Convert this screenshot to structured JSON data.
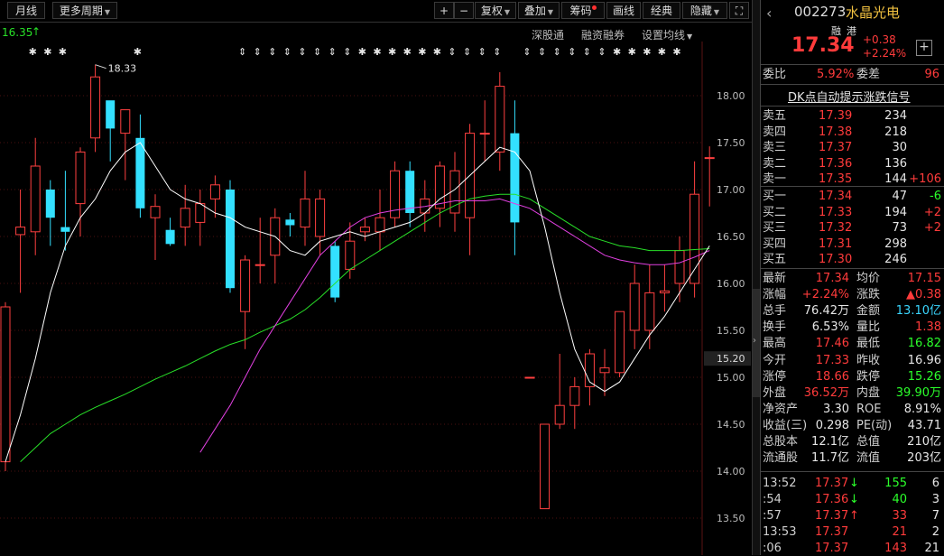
{
  "toolbar": {
    "left_buttons": [
      {
        "label": "月线",
        "has_caret": false
      },
      {
        "label": "更多周期",
        "has_caret": true
      }
    ],
    "right_buttons": [
      {
        "label": "+",
        "has_caret": false
      },
      {
        "label": "−",
        "has_caret": false
      },
      {
        "label": "复权",
        "has_caret": true
      },
      {
        "label": "叠加",
        "has_caret": true
      },
      {
        "label": "筹码",
        "has_caret": false,
        "dot": true
      },
      {
        "label": "画线",
        "has_caret": false
      },
      {
        "label": "经典",
        "has_caret": false
      },
      {
        "label": "隐藏",
        "has_caret": true
      },
      {
        "label": "⛶",
        "has_caret": false
      }
    ]
  },
  "subbar": {
    "indicator_value": "16.35",
    "indicator_arrow": "↑",
    "links": [
      "深股通",
      "融资融券",
      "设置均线"
    ]
  },
  "chart_data": {
    "type": "candlestick",
    "ylim": [
      13.35,
      18.35
    ],
    "y_ticks": [
      13.5,
      14.0,
      14.5,
      15.0,
      15.5,
      16.0,
      16.5,
      17.0,
      17.5,
      18.0
    ],
    "current_price_label": "15.20",
    "high_annotation": "18.33",
    "colors": {
      "up": "#ff4040",
      "down": "#33e0ff",
      "ma5": "#ffffff",
      "ma10": "#e040e0",
      "ma20": "#28e028",
      "grid": "#4a1010"
    },
    "candles": [
      {
        "o": 14.1,
        "h": 15.8,
        "l": 14.0,
        "c": 15.75
      },
      {
        "o": 16.52,
        "h": 17.0,
        "l": 15.9,
        "c": 16.6
      },
      {
        "o": 16.55,
        "h": 17.55,
        "l": 16.3,
        "c": 17.25
      },
      {
        "o": 17.0,
        "h": 17.1,
        "l": 16.4,
        "c": 16.7
      },
      {
        "o": 16.6,
        "h": 17.2,
        "l": 16.35,
        "c": 16.55
      },
      {
        "o": 16.85,
        "h": 17.45,
        "l": 16.5,
        "c": 17.4
      },
      {
        "o": 17.55,
        "h": 18.33,
        "l": 17.4,
        "c": 18.2
      },
      {
        "o": 17.95,
        "h": 17.9,
        "l": 17.3,
        "c": 17.65
      },
      {
        "o": 17.6,
        "h": 17.85,
        "l": 17.1,
        "c": 17.85
      },
      {
        "o": 17.55,
        "h": 17.8,
        "l": 16.7,
        "c": 16.8
      },
      {
        "o": 16.7,
        "h": 16.95,
        "l": 16.25,
        "c": 16.82
      },
      {
        "o": 16.57,
        "h": 16.7,
        "l": 16.4,
        "c": 16.42
      },
      {
        "o": 16.6,
        "h": 17.05,
        "l": 16.4,
        "c": 16.8
      },
      {
        "o": 16.65,
        "h": 17.0,
        "l": 16.4,
        "c": 16.85
      },
      {
        "o": 16.9,
        "h": 17.15,
        "l": 16.7,
        "c": 17.05
      },
      {
        "o": 17.0,
        "h": 17.1,
        "l": 15.9,
        "c": 15.95
      },
      {
        "o": 15.7,
        "h": 16.3,
        "l": 15.3,
        "c": 16.25
      },
      {
        "o": 16.2,
        "h": 16.7,
        "l": 16.0,
        "c": 16.2
      },
      {
        "o": 16.3,
        "h": 16.8,
        "l": 16.0,
        "c": 16.7
      },
      {
        "o": 16.68,
        "h": 16.75,
        "l": 16.5,
        "c": 16.62
      },
      {
        "o": 16.6,
        "h": 17.2,
        "l": 16.4,
        "c": 16.9
      },
      {
        "o": 16.5,
        "h": 17.0,
        "l": 16.3,
        "c": 16.9
      },
      {
        "o": 16.4,
        "h": 16.45,
        "l": 15.8,
        "c": 15.85
      },
      {
        "o": 16.15,
        "h": 16.65,
        "l": 16.05,
        "c": 16.45
      },
      {
        "o": 16.55,
        "h": 16.7,
        "l": 16.45,
        "c": 16.6
      },
      {
        "o": 16.55,
        "h": 17.0,
        "l": 16.35,
        "c": 16.7
      },
      {
        "o": 16.7,
        "h": 17.3,
        "l": 16.6,
        "c": 17.2
      },
      {
        "o": 17.2,
        "h": 17.3,
        "l": 16.6,
        "c": 16.75
      },
      {
        "o": 16.75,
        "h": 17.1,
        "l": 16.55,
        "c": 16.9
      },
      {
        "o": 16.8,
        "h": 17.3,
        "l": 16.6,
        "c": 17.25
      },
      {
        "o": 16.75,
        "h": 17.4,
        "l": 16.55,
        "c": 17.2
      },
      {
        "o": 16.7,
        "h": 17.7,
        "l": 16.3,
        "c": 17.6
      },
      {
        "o": 17.6,
        "h": 17.95,
        "l": 17.3,
        "c": 17.6
      },
      {
        "o": 17.4,
        "h": 18.25,
        "l": 17.2,
        "c": 18.1
      },
      {
        "o": 17.6,
        "h": 17.95,
        "l": 16.3,
        "c": 16.65
      },
      {
        "o": 15.0,
        "h": 15.0,
        "l": 15.0,
        "c": 15.0
      },
      {
        "o": 13.6,
        "h": 14.5,
        "l": 13.6,
        "c": 14.5
      },
      {
        "o": 14.5,
        "h": 15.25,
        "l": 14.45,
        "c": 14.7
      },
      {
        "o": 14.7,
        "h": 15.0,
        "l": 14.45,
        "c": 14.9
      },
      {
        "o": 14.9,
        "h": 15.3,
        "l": 14.7,
        "c": 15.25
      },
      {
        "o": 15.05,
        "h": 15.3,
        "l": 14.8,
        "c": 15.1
      },
      {
        "o": 15.05,
        "h": 15.7,
        "l": 15.0,
        "c": 15.7
      },
      {
        "o": 15.5,
        "h": 16.2,
        "l": 15.3,
        "c": 16.0
      },
      {
        "o": 15.5,
        "h": 16.2,
        "l": 15.3,
        "c": 15.9
      },
      {
        "o": 15.9,
        "h": 16.2,
        "l": 15.7,
        "c": 15.92
      },
      {
        "o": 16.0,
        "h": 16.5,
        "l": 15.8,
        "c": 16.35
      },
      {
        "o": 16.0,
        "h": 17.3,
        "l": 15.85,
        "c": 16.95
      },
      {
        "o": 17.34,
        "h": 17.46,
        "l": 16.82,
        "c": 17.34
      }
    ],
    "ma5": [
      14.1,
      14.6,
      15.2,
      15.9,
      16.4,
      16.7,
      16.9,
      17.2,
      17.4,
      17.5,
      17.25,
      17.0,
      16.9,
      16.85,
      16.75,
      16.7,
      16.6,
      16.55,
      16.5,
      16.35,
      16.3,
      16.45,
      16.5,
      16.55,
      16.5,
      16.55,
      16.6,
      16.65,
      16.75,
      16.9,
      17.0,
      17.15,
      17.3,
      17.45,
      17.4,
      17.2,
      16.6,
      15.9,
      15.3,
      14.95,
      14.85,
      14.95,
      15.2,
      15.45,
      15.65,
      15.9,
      16.15,
      16.4
    ],
    "ma10": [
      null,
      null,
      null,
      null,
      null,
      null,
      null,
      null,
      null,
      null,
      null,
      null,
      null,
      14.2,
      14.45,
      14.7,
      15.0,
      15.3,
      15.55,
      15.8,
      16.05,
      16.3,
      16.45,
      16.6,
      16.7,
      16.75,
      16.78,
      16.8,
      16.82,
      16.85,
      16.88,
      16.88,
      16.88,
      16.9,
      16.85,
      16.8,
      16.7,
      16.6,
      16.5,
      16.4,
      16.3,
      16.25,
      16.22,
      16.2,
      16.2,
      16.22,
      16.28,
      16.35
    ],
    "ma20": [
      null,
      14.1,
      14.25,
      14.4,
      14.5,
      14.6,
      14.68,
      14.75,
      14.82,
      14.9,
      14.98,
      15.05,
      15.12,
      15.2,
      15.28,
      15.35,
      15.4,
      15.48,
      15.55,
      15.62,
      15.72,
      15.85,
      16.0,
      16.15,
      16.25,
      16.35,
      16.45,
      16.55,
      16.65,
      16.75,
      16.83,
      16.9,
      16.93,
      16.95,
      16.95,
      16.9,
      16.8,
      16.7,
      16.6,
      16.5,
      16.45,
      16.4,
      16.38,
      16.35,
      16.35,
      16.35,
      16.36,
      16.37
    ],
    "top_markers": [
      {
        "idx": 2,
        "sym": "✱"
      },
      {
        "idx": 3,
        "sym": "✱"
      },
      {
        "idx": 4,
        "sym": "✱"
      },
      {
        "idx": 9,
        "sym": "✱"
      },
      {
        "idx": 16,
        "sym": "⇕"
      },
      {
        "idx": 17,
        "sym": "⇕"
      },
      {
        "idx": 18,
        "sym": "⇕"
      },
      {
        "idx": 19,
        "sym": "⇕"
      },
      {
        "idx": 20,
        "sym": "⇕"
      },
      {
        "idx": 21,
        "sym": "⇕"
      },
      {
        "idx": 22,
        "sym": "⇕"
      },
      {
        "idx": 23,
        "sym": "⇕"
      },
      {
        "idx": 24,
        "sym": "✱"
      },
      {
        "idx": 25,
        "sym": "✱"
      },
      {
        "idx": 26,
        "sym": "✱"
      },
      {
        "idx": 27,
        "sym": "✱"
      },
      {
        "idx": 28,
        "sym": "✱"
      },
      {
        "idx": 29,
        "sym": "✱"
      },
      {
        "idx": 30,
        "sym": "⇕"
      },
      {
        "idx": 31,
        "sym": "⇕"
      },
      {
        "idx": 32,
        "sym": "⇕"
      },
      {
        "idx": 33,
        "sym": "⇕"
      },
      {
        "idx": 35,
        "sym": "⇕"
      },
      {
        "idx": 36,
        "sym": "⇕"
      },
      {
        "idx": 37,
        "sym": "⇕"
      },
      {
        "idx": 38,
        "sym": "⇕"
      },
      {
        "idx": 39,
        "sym": "⇕"
      },
      {
        "idx": 40,
        "sym": "⇕"
      },
      {
        "idx": 41,
        "sym": "✱"
      },
      {
        "idx": 42,
        "sym": "✱"
      },
      {
        "idx": 43,
        "sym": "✱"
      },
      {
        "idx": 44,
        "sym": "✱"
      },
      {
        "idx": 45,
        "sym": "✱"
      }
    ]
  },
  "quote": {
    "code": "002273",
    "name": "水晶光电",
    "badges": [
      "融",
      "港"
    ],
    "price": "17.34",
    "change": "+0.38",
    "change_pct": "+2.24%",
    "weibi_label": "委比",
    "weibi": "5.92%",
    "weicha_label": "委差",
    "weicha": "96",
    "dk_text": "DK点自动提示涨跌信号",
    "asks": [
      {
        "label": "卖五",
        "price": "17.39",
        "vol": "234",
        "delta": ""
      },
      {
        "label": "卖四",
        "price": "17.38",
        "vol": "218",
        "delta": ""
      },
      {
        "label": "卖三",
        "price": "17.37",
        "vol": "30",
        "delta": ""
      },
      {
        "label": "卖二",
        "price": "17.36",
        "vol": "136",
        "delta": ""
      },
      {
        "label": "卖一",
        "price": "17.35",
        "vol": "144",
        "delta": "+106"
      }
    ],
    "bids": [
      {
        "label": "买一",
        "price": "17.34",
        "vol": "47",
        "delta": "-6"
      },
      {
        "label": "买二",
        "price": "17.33",
        "vol": "194",
        "delta": "+2"
      },
      {
        "label": "买三",
        "price": "17.32",
        "vol": "73",
        "delta": "+2"
      },
      {
        "label": "买四",
        "price": "17.31",
        "vol": "298",
        "delta": ""
      },
      {
        "label": "买五",
        "price": "17.30",
        "vol": "246",
        "delta": ""
      }
    ],
    "stats": [
      {
        "l1": "最新",
        "v1": "17.34",
        "c1": "red",
        "l2": "均价",
        "v2": "17.15",
        "c2": "red"
      },
      {
        "l1": "涨幅",
        "v1": "+2.24%",
        "c1": "red",
        "l2": "涨跌",
        "v2": "▲0.38",
        "c2": "red"
      },
      {
        "l1": "总手",
        "v1": "76.42万",
        "c1": "white",
        "l2": "金额",
        "v2": "13.10亿",
        "c2": "cyan"
      },
      {
        "l1": "换手",
        "v1": "6.53%",
        "c1": "white",
        "l2": "量比",
        "v2": "1.38",
        "c2": "red"
      },
      {
        "l1": "最高",
        "v1": "17.46",
        "c1": "red",
        "l2": "最低",
        "v2": "16.82",
        "c2": "green"
      },
      {
        "l1": "今开",
        "v1": "17.33",
        "c1": "red",
        "l2": "昨收",
        "v2": "16.96",
        "c2": "white"
      },
      {
        "l1": "涨停",
        "v1": "18.66",
        "c1": "red",
        "l2": "跌停",
        "v2": "15.26",
        "c2": "green"
      },
      {
        "l1": "外盘",
        "v1": "36.52万",
        "c1": "red",
        "l2": "内盘",
        "v2": "39.90万",
        "c2": "green"
      },
      {
        "l1": "净资产",
        "v1": "3.30",
        "c1": "white",
        "l2": "ROE",
        "v2": "8.91%",
        "c2": "white"
      },
      {
        "l1": "收益(三)",
        "v1": "0.298",
        "c1": "white",
        "l2": "PE(动)",
        "v2": "43.71",
        "c2": "white"
      },
      {
        "l1": "总股本",
        "v1": "12.1亿",
        "c1": "white",
        "l2": "总值",
        "v2": "210亿",
        "c2": "white"
      },
      {
        "l1": "流通股",
        "v1": "11.7亿",
        "c1": "white",
        "l2": "流值",
        "v2": "203亿",
        "c2": "white"
      }
    ],
    "ticks": [
      {
        "time": "13:52",
        "price": "17.37",
        "arrow": "↓",
        "arrow_color": "green",
        "vol": "155",
        "vol_color": "green",
        "n": "6"
      },
      {
        "time": ":54",
        "price": "17.36",
        "arrow": "↓",
        "arrow_color": "green",
        "vol": "40",
        "vol_color": "green",
        "n": "3"
      },
      {
        "time": ":57",
        "price": "17.37",
        "arrow": "↑",
        "arrow_color": "red",
        "vol": "33",
        "vol_color": "red",
        "n": "7"
      },
      {
        "time": "13:53",
        "price": "17.37",
        "arrow": "",
        "arrow_color": "red",
        "vol": "21",
        "vol_color": "red",
        "n": "2"
      },
      {
        "time": ":06",
        "price": "17.37",
        "arrow": "",
        "arrow_color": "red",
        "vol": "143",
        "vol_color": "red",
        "n": "21"
      }
    ]
  }
}
